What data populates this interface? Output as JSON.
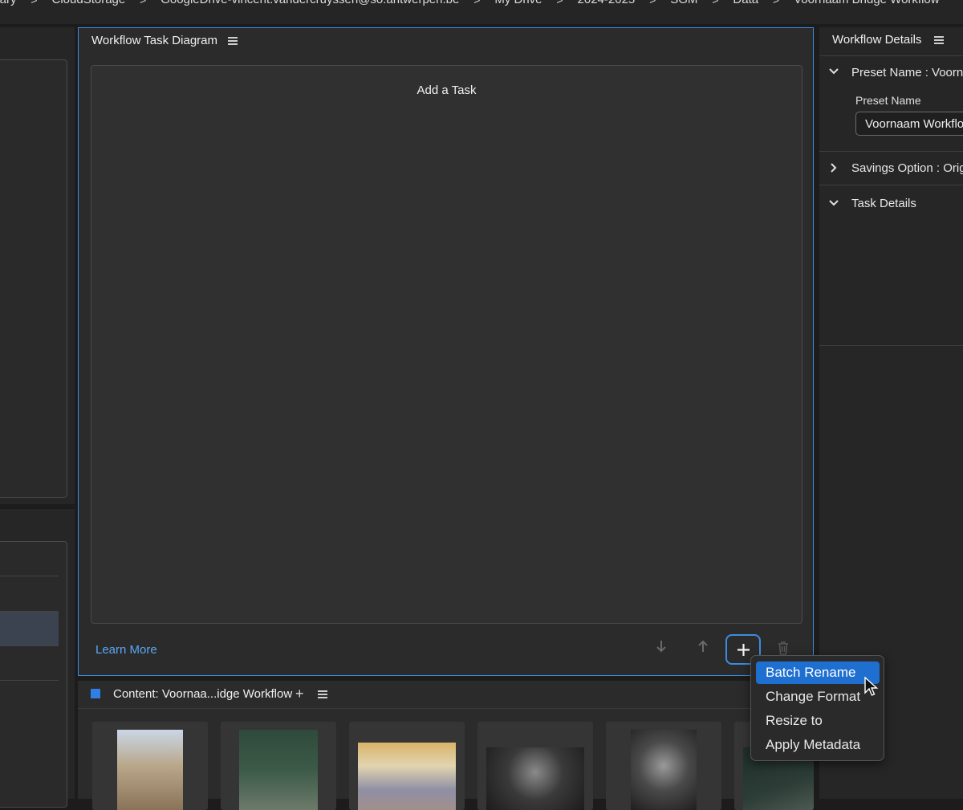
{
  "breadcrumb": [
    "ibrary",
    "CloudStorage",
    "GoogleDrive-vincent.vandercruyssen@so.antwerpen.be",
    "My Drive",
    "2024-2025",
    "SGM",
    "Data",
    "Voornaam Bridge Workflow"
  ],
  "workflow_task_diagram": {
    "title": "Workflow Task Diagram",
    "empty_text": "Add a Task",
    "learn_more": "Learn More"
  },
  "workflow_details": {
    "title": "Workflow Details",
    "sections": [
      {
        "title": "Preset Name : Voorna",
        "expanded": true
      },
      {
        "title": "Savings Option : Orig",
        "expanded": false
      },
      {
        "title": "Task Details",
        "expanded": true
      }
    ],
    "preset_label": "Preset Name",
    "preset_value": "Voornaam Workflo"
  },
  "content": {
    "title": "Content: Voornaa...idge Workflow",
    "accent": "#2f7fe6"
  },
  "add_task_menu": {
    "items": [
      "Batch Rename",
      "Change Format",
      "Resize to",
      "Apply Metadata"
    ],
    "highlighted": "Batch Rename"
  },
  "colors": {
    "focus_border": "#3d8be0",
    "link": "#5aa8f5",
    "menu_highlight": "#1f6fd1"
  }
}
